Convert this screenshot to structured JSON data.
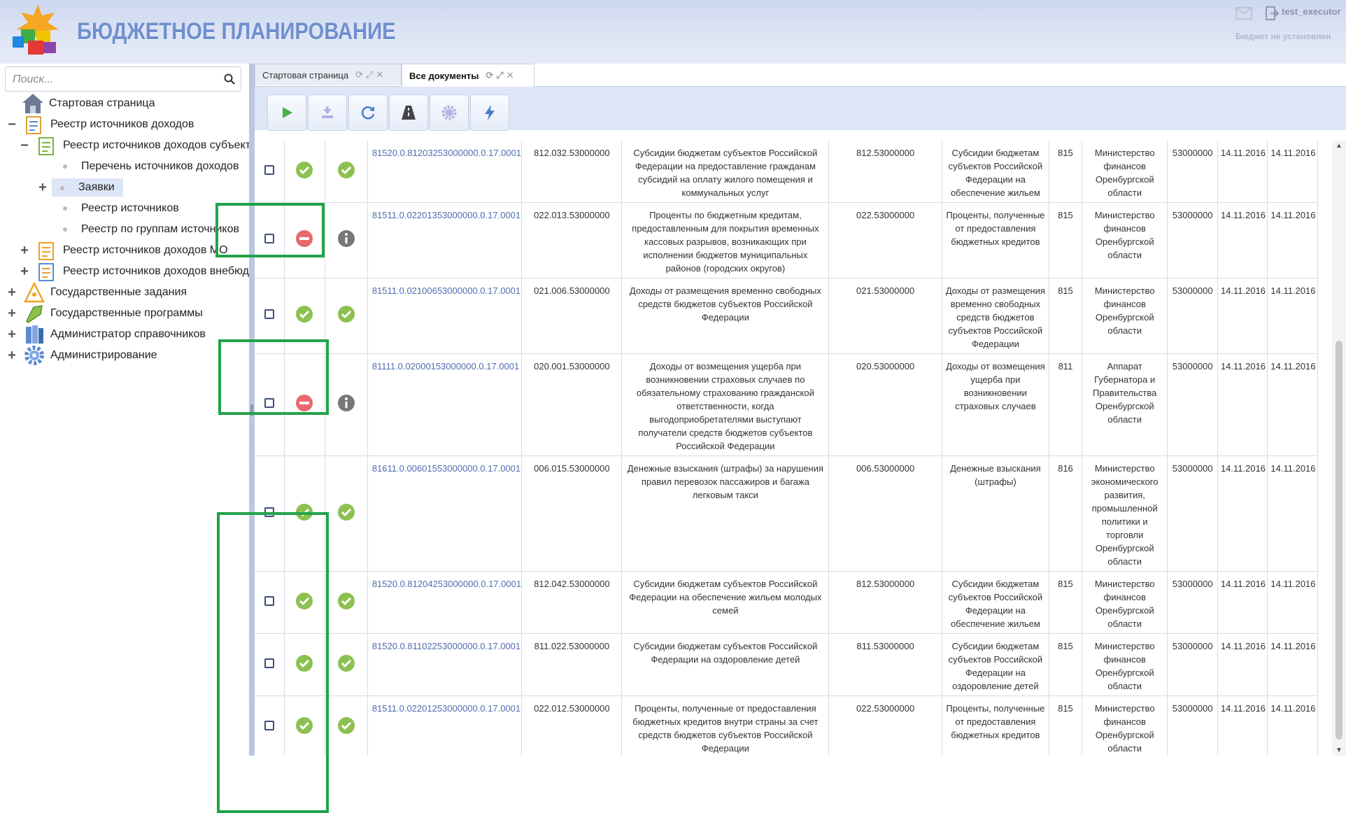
{
  "header": {
    "app_title": "БЮДЖЕТНОЕ ПЛАНИРОВАНИЕ",
    "user_name": "test_executor",
    "budget_status": "Бюджет не установлен"
  },
  "sidebar": {
    "search_placeholder": "Поиск...",
    "items": [
      {
        "label": "Стартовая страница"
      },
      {
        "label": "Реестр источников доходов"
      },
      {
        "label": "Реестр источников доходов субъект"
      },
      {
        "label": "Перечень источников доходов"
      },
      {
        "label": "Заявки"
      },
      {
        "label": "Реестр источников"
      },
      {
        "label": "Реестр по группам источников"
      },
      {
        "label": "Реестр источников доходов МО"
      },
      {
        "label": "Реестр источников доходов внебюд"
      },
      {
        "label": "Государственные задания"
      },
      {
        "label": "Государственные программы"
      },
      {
        "label": "Администратор справочников"
      },
      {
        "label": "Администрирование"
      }
    ]
  },
  "tabs": [
    {
      "label": "Стартовая страница"
    },
    {
      "label": "Все документы"
    }
  ],
  "toolbar_icons": [
    "play-icon",
    "export-icon",
    "refresh-icon",
    "road-icon",
    "gear-icon",
    "lightning-icon"
  ],
  "colors": {
    "ok": "#8cc152",
    "deny": "#e9686b",
    "info": "#777777",
    "highlight": "#22a34a",
    "link": "#4f6bb0"
  },
  "rows": [
    {
      "status": "ok",
      "state": "ok",
      "code": "81520.0.81203253000000.0.17.0001",
      "num": "812.032.53000000",
      "name": "Субсидии бюджетам субъектов Российской Федерации на предоставление гражданам субсидий на оплату жилого помещения и коммунальных услуг",
      "code2": "812.53000000",
      "group": "Субсидии бюджетам субъектов Российской Федерации на обеспечение жильем",
      "adm": "815",
      "org": "Министерство финансов Оренбургской области",
      "okato": "53000000",
      "date1": "14.11.2016",
      "date2": "14.11.2016"
    },
    {
      "status": "deny",
      "state": "info",
      "code": "81511.0.02201353000000.0.17.0001",
      "num": "022.013.53000000",
      "name": "Проценты по бюджетным кредитам, предоставленным для покрытия временных кассовых разрывов, возникающих при исполнении бюджетов муниципальных районов (городских округов)",
      "code2": "022.53000000",
      "group": "Проценты, полученные от предоставления бюджетных кредитов",
      "adm": "815",
      "org": "Министерство финансов Оренбургской области",
      "okato": "53000000",
      "date1": "14.11.2016",
      "date2": "14.11.2016"
    },
    {
      "status": "ok",
      "state": "ok",
      "code": "81511.0.02100653000000.0.17.0001",
      "num": "021.006.53000000",
      "name": "Доходы от размещения временно свободных средств бюджетов субъектов Российской Федерации",
      "code2": "021.53000000",
      "group": "Доходы от размещения временно свободных средств бюджетов субъектов Российской Федерации",
      "adm": "815",
      "org": "Министерство финансов Оренбургской области",
      "okato": "53000000",
      "date1": "14.11.2016",
      "date2": "14.11.2016"
    },
    {
      "status": "deny",
      "state": "info",
      "code": "81111.0.02000153000000.0.17.0001",
      "num": "020.001.53000000",
      "name": "Доходы от возмещения ущерба при возникновении страховых случаев по обязательному страхованию гражданской ответственности, когда выгодоприобретателями выступают получатели средств бюджетов субъектов Российской Федерации",
      "code2": "020.53000000",
      "group": "Доходы от возмещения ущерба при возникновении страховых случаев",
      "adm": "811",
      "org": "Аппарат Губернатора и Правительства Оренбургской области",
      "okato": "53000000",
      "date1": "14.11.2016",
      "date2": "14.11.2016"
    },
    {
      "status": "ok",
      "state": "ok",
      "code": "81611.0.00601553000000.0.17.0001",
      "num": "006.015.53000000",
      "name": "Денежные взыскания (штрафы) за нарушения правил перевозок пассажиров и багажа легковым такси",
      "code2": "006.53000000",
      "group": "Денежные взыскания (штрафы)",
      "adm": "816",
      "org": "Министерство экономического развития, промышленной политики и торговли Оренбургской области",
      "okato": "53000000",
      "date1": "14.11.2016",
      "date2": "14.11.2016"
    },
    {
      "status": "ok",
      "state": "ok",
      "code": "81520.0.81204253000000.0.17.0001",
      "num": "812.042.53000000",
      "name": "Субсидии бюджетам субъектов Российской Федерации на обеспечение жильем молодых семей",
      "code2": "812.53000000",
      "group": "Субсидии бюджетам субъектов Российской Федерации на обеспечение жильем",
      "adm": "815",
      "org": "Министерство финансов Оренбургской области",
      "okato": "53000000",
      "date1": "14.11.2016",
      "date2": "14.11.2016"
    },
    {
      "status": "ok",
      "state": "ok",
      "code": "81520.0.81102253000000.0.17.0001",
      "num": "811.022.53000000",
      "name": "Субсидии бюджетам субъектов Российской Федерации на оздоровление детей",
      "code2": "811.53000000",
      "group": "Субсидии бюджетам субъектов Российской Федерации на оздоровление детей",
      "adm": "815",
      "org": "Министерство финансов Оренбургской области",
      "okato": "53000000",
      "date1": "14.11.2016",
      "date2": "14.11.2016"
    },
    {
      "status": "ok",
      "state": "ok",
      "code": "81511.0.02201253000000.0.17.0001",
      "num": "022.012.53000000",
      "name": "Проценты, полученные от предоставления бюджетных кредитов внутри страны за счет средств бюджетов субъектов Российской Федерации",
      "code2": "022.53000000",
      "group": "Проценты, полученные от предоставления бюджетных кредитов",
      "adm": "815",
      "org": "Министерство финансов Оренбургской области",
      "okato": "53000000",
      "date1": "14.11.2016",
      "date2": "14.11.2016"
    }
  ]
}
